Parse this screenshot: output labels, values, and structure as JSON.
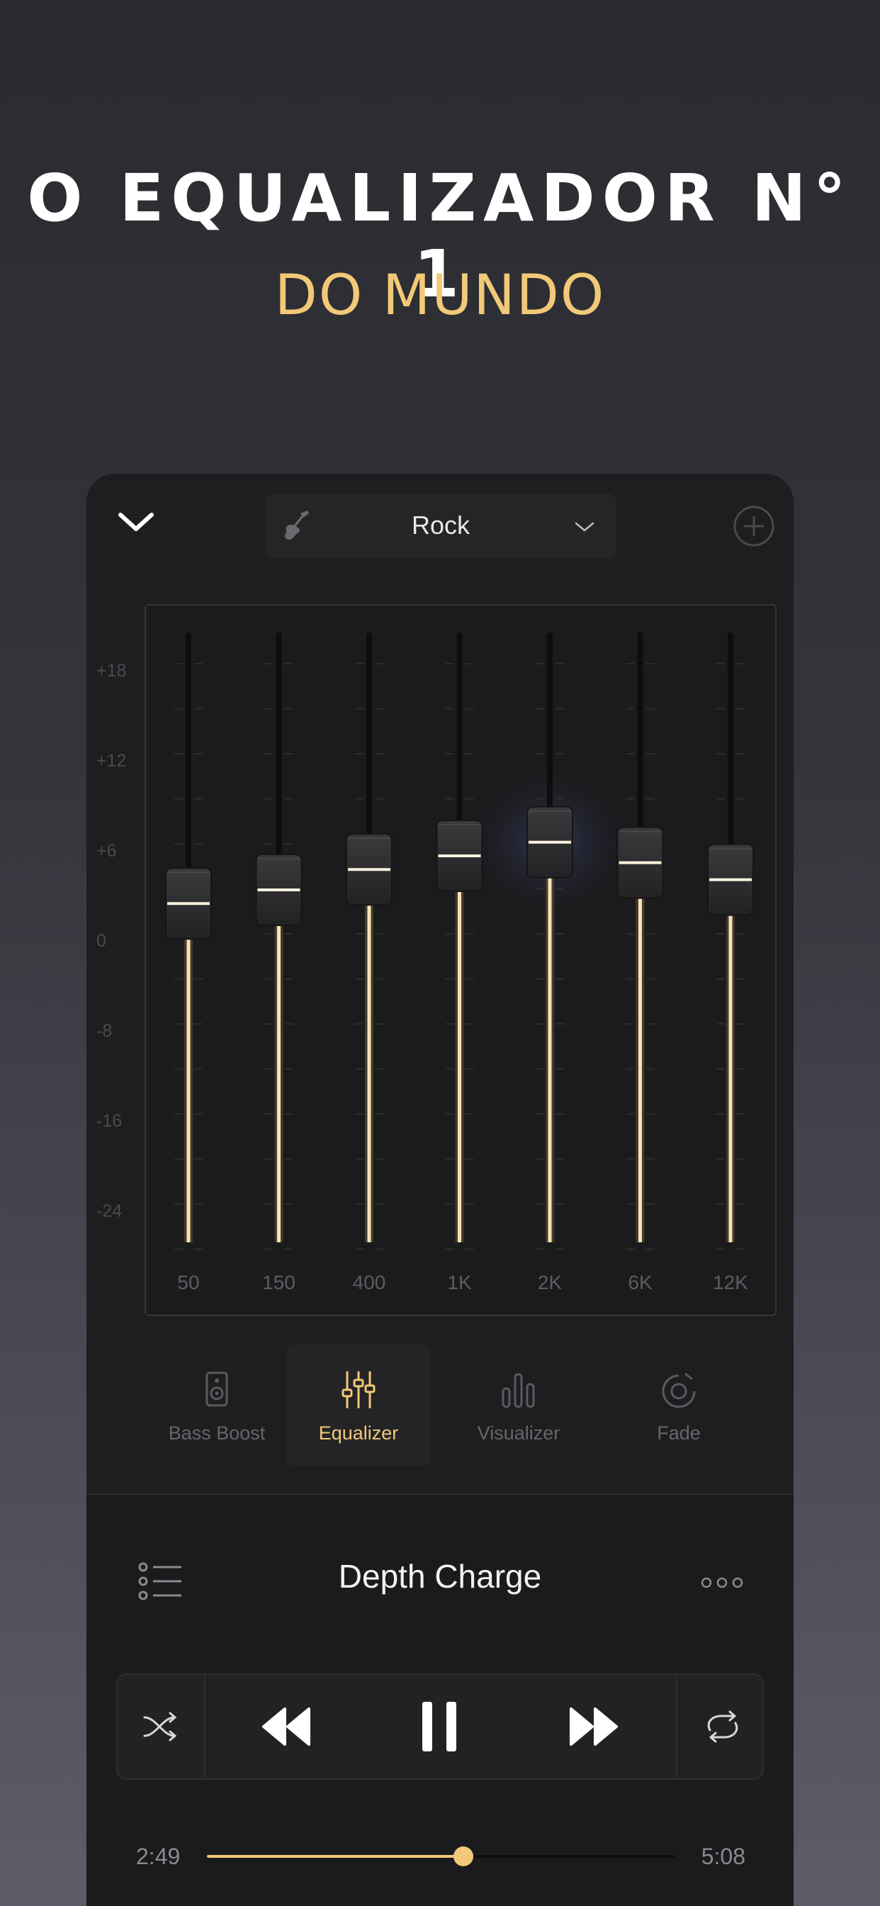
{
  "headline": {
    "line1": "O EQUALIZADOR N° 1",
    "line2": "DO MUNDO"
  },
  "colors": {
    "accent": "#f2c978",
    "panel": "#1e1e20",
    "text_dim": "#66666b"
  },
  "top_bar": {
    "collapse_icon": "chevron-down-icon",
    "preset_icon": "guitar-icon",
    "preset_name": "Rock",
    "dropdown_icon": "chevron-down-icon",
    "add_icon": "plus-circle-icon"
  },
  "equalizer": {
    "db_scale": [
      "+18",
      "+12",
      "+6",
      "0",
      "-8",
      "-16",
      "-24"
    ],
    "bands": [
      {
        "label": "50",
        "gain_db": -2
      },
      {
        "label": "150",
        "gain_db": 0
      },
      {
        "label": "400",
        "gain_db": 3
      },
      {
        "label": "1K",
        "gain_db": 5
      },
      {
        "label": "2K",
        "gain_db": 7
      },
      {
        "label": "6K",
        "gain_db": 4
      },
      {
        "label": "12K",
        "gain_db": 1.5
      }
    ]
  },
  "tabs": [
    {
      "label": "Bass Boost",
      "icon": "speaker-icon",
      "active": false
    },
    {
      "label": "Equalizer",
      "icon": "sliders-icon",
      "active": true
    },
    {
      "label": "Visualizer",
      "icon": "bars-icon",
      "active": false
    },
    {
      "label": "Fade",
      "icon": "fade-icon",
      "active": false
    }
  ],
  "player": {
    "song_title": "Depth Charge",
    "queue_icon": "list-icon",
    "more_icon": "more-icon",
    "controls": [
      "shuffle-icon",
      "rewind-icon",
      "pause-icon",
      "fast-forward-icon",
      "repeat-icon"
    ],
    "elapsed": "2:49",
    "total": "5:08",
    "progress": 0.548
  }
}
